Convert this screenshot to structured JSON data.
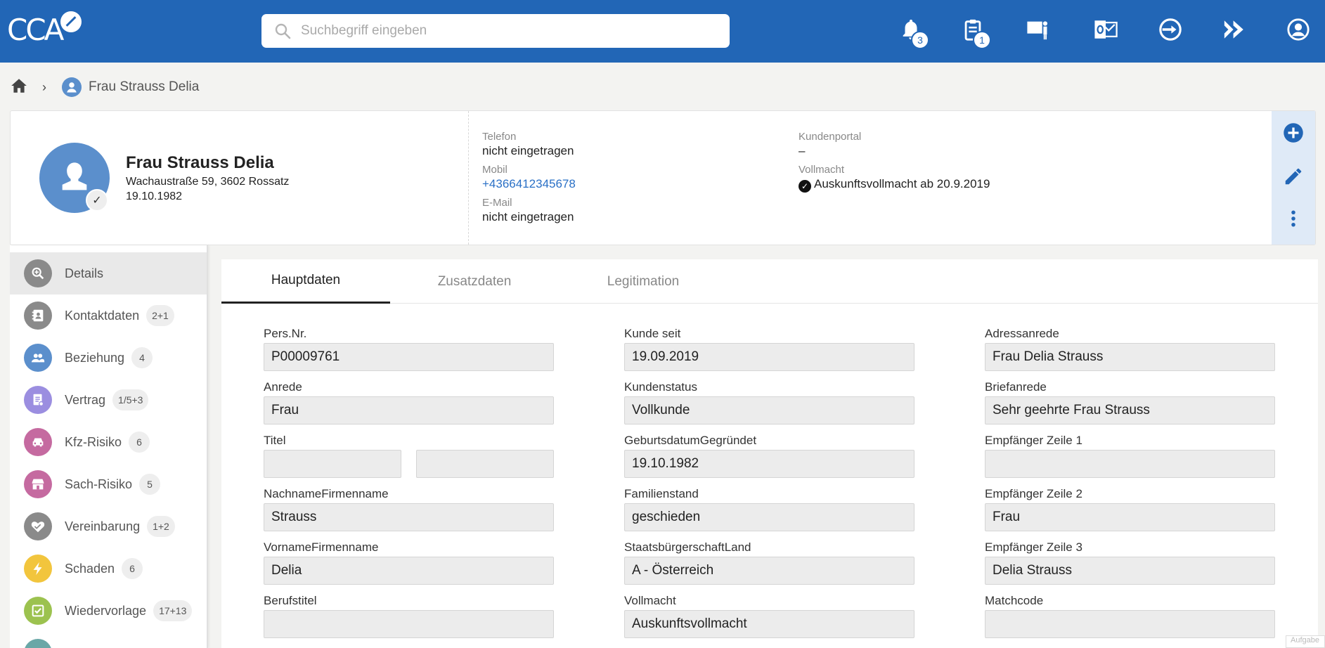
{
  "app": {
    "logo_text": "CCA",
    "search_placeholder": "Suchbegriff eingeben",
    "top_icons": [
      {
        "name": "bell-icon",
        "badge": "3"
      },
      {
        "name": "clipboard-icon",
        "badge": "1"
      },
      {
        "name": "presentation-icon"
      },
      {
        "name": "outlook-icon"
      },
      {
        "name": "transfer-icon"
      },
      {
        "name": "fast-forward-icon"
      },
      {
        "name": "user-account-icon"
      }
    ]
  },
  "breadcrumb": {
    "separator": "›",
    "current": "Frau Strauss Delia"
  },
  "person": {
    "name": "Frau Strauss Delia",
    "address": "Wachaustraße 59, 3602 Rossatz",
    "birthdate": "19.10.1982",
    "verified_mark": "✓"
  },
  "contact": {
    "telefon_label": "Telefon",
    "telefon_value": "nicht eingetragen",
    "mobil_label": "Mobil",
    "mobil_value": "+4366412345678",
    "email_label": "E-Mail",
    "email_value": "nicht eingetragen",
    "portal_label": "Kundenportal",
    "portal_value": "–",
    "vollmacht_label": "Vollmacht",
    "vollmacht_value": "Auskunftsvollmacht ab 20.9.2019"
  },
  "sidebar": {
    "items": [
      {
        "label": "Details",
        "count": "",
        "color": "#8a8a8a"
      },
      {
        "label": "Kontaktdaten",
        "count": "2+1",
        "color": "#8a8a8a"
      },
      {
        "label": "Beziehung",
        "count": "4",
        "color": "#5b8fcc"
      },
      {
        "label": "Vertrag",
        "count": "1/5+3",
        "color": "#9b8ee0"
      },
      {
        "label": "Kfz-Risiko",
        "count": "6",
        "color": "#c56aa0"
      },
      {
        "label": "Sach-Risiko",
        "count": "5",
        "color": "#c56aa0"
      },
      {
        "label": "Vereinbarung",
        "count": "1+2",
        "color": "#8a8a8a"
      },
      {
        "label": "Schaden",
        "count": "6",
        "color": "#f2c53d"
      },
      {
        "label": "Wiedervorlage",
        "count": "17+13",
        "color": "#9cc24f"
      },
      {
        "label": "",
        "count": "",
        "color": "#6aa7a7"
      }
    ]
  },
  "tabs": [
    {
      "label": "Hauptdaten",
      "active": true
    },
    {
      "label": "Zusatzdaten",
      "active": false
    },
    {
      "label": "Legitimation",
      "active": false
    }
  ],
  "form": {
    "col1": [
      {
        "label": "Pers.Nr.",
        "value": "P00009761"
      },
      {
        "label": "Anrede",
        "value": "Frau"
      },
      {
        "label": "Titel",
        "value": "",
        "value2": ""
      },
      {
        "label": "NachnameFirmenname",
        "value": "Strauss"
      },
      {
        "label": "VornameFirmenname",
        "value": "Delia"
      },
      {
        "label": "Berufstitel",
        "value": ""
      }
    ],
    "col2": [
      {
        "label": "Kunde seit",
        "value": "19.09.2019"
      },
      {
        "label": "Kundenstatus",
        "value": "Vollkunde"
      },
      {
        "label": "GeburtsdatumGegründet",
        "value": "19.10.1982"
      },
      {
        "label": "Familienstand",
        "value": "geschieden"
      },
      {
        "label": "StaatsbürgerschaftLand",
        "value": "A - Österreich"
      },
      {
        "label": "Vollmacht",
        "value": "Auskunftsvollmacht"
      }
    ],
    "col3": [
      {
        "label": "Adressanrede",
        "value": "Frau Delia Strauss"
      },
      {
        "label": "Briefanrede",
        "value": "Sehr geehrte Frau Strauss"
      },
      {
        "label": "Empfänger Zeile 1",
        "value": ""
      },
      {
        "label": "Empfänger Zeile 2",
        "value": "Frau"
      },
      {
        "label": "Empfänger Zeile 3",
        "value": "Delia Strauss"
      },
      {
        "label": "Matchcode",
        "value": ""
      }
    ]
  },
  "corner_text": "Aufgabe",
  "colors": {
    "brand": "#2266b6",
    "accent_link": "#2a70c6",
    "rail_bg": "#dfeaf7"
  }
}
